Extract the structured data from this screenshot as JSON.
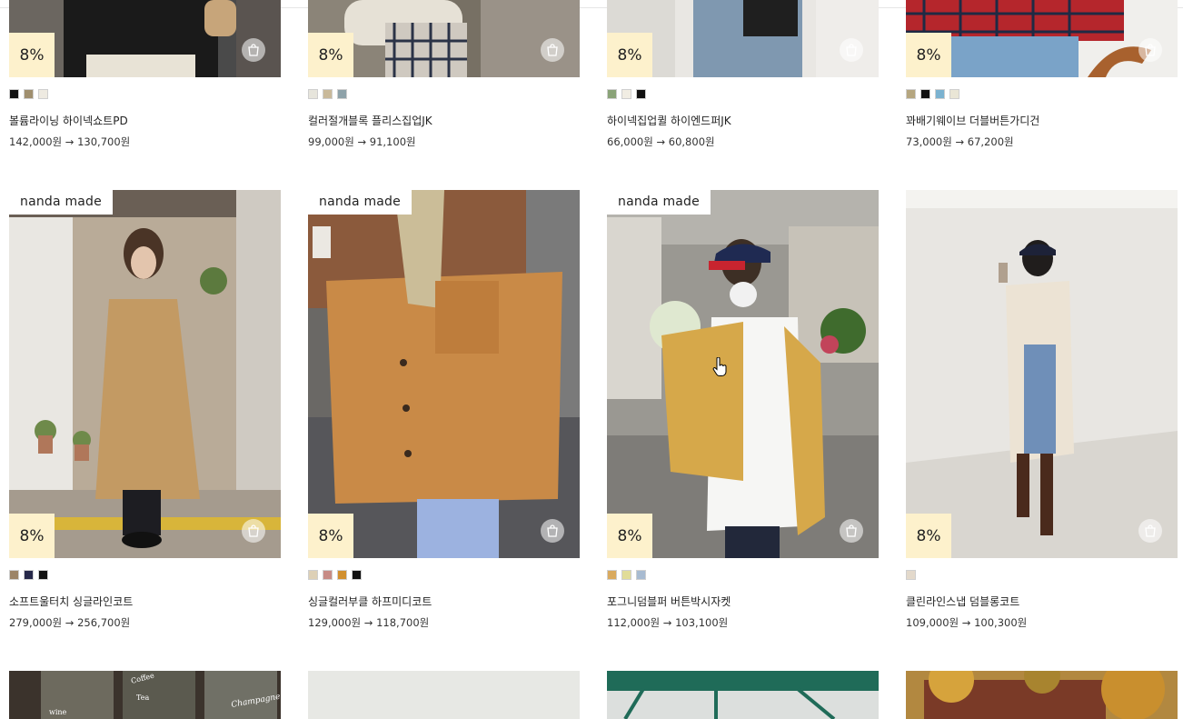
{
  "products": [
    {
      "made": "",
      "discount": "8%",
      "colors": [
        "#111111",
        "#a08f6e",
        "#eeeae1"
      ],
      "name": "볼륨라이닝 하이넥쇼트PD",
      "price": "142,000원 → 130,700원",
      "img": "row0-a"
    },
    {
      "made": "",
      "discount": "8%",
      "colors": [
        "#e7e5dc",
        "#c9b99a",
        "#8ea2a9"
      ],
      "name": "컬러절개블록 플리스집업JK",
      "price": "99,000원 → 91,100원",
      "img": "row0-b"
    },
    {
      "made": "",
      "discount": "8%",
      "colors": [
        "#8aa378",
        "#f1ede3",
        "#111111"
      ],
      "name": "하이넥집업퀼 하이엔드퍼JK",
      "price": "66,000원 → 60,800원",
      "img": "row0-c"
    },
    {
      "made": "",
      "discount": "8%",
      "colors": [
        "#b5a67f",
        "#111111",
        "#7bb2d0",
        "#eae6d6"
      ],
      "name": "꽈배기웨이브 더블버튼가디건",
      "price": "73,000원 → 67,200원",
      "img": "row0-d"
    },
    {
      "made": "nanda made",
      "discount": "8%",
      "colors": [
        "#9c8468",
        "#27294a",
        "#111111"
      ],
      "name": "소프트울터치 싱글라인코트",
      "price": "279,000원 → 256,700원",
      "img": "row1-a"
    },
    {
      "made": "nanda made",
      "discount": "8%",
      "colors": [
        "#ddd0b6",
        "#c78b85",
        "#d1902f",
        "#111111"
      ],
      "name": "싱글컬러부클 하프미디코트",
      "price": "129,000원 → 118,700원",
      "img": "row1-b"
    },
    {
      "made": "nanda made",
      "discount": "8%",
      "colors": [
        "#d9aa5f",
        "#e1dc98",
        "#a8bbd1"
      ],
      "name": "포그니덤블퍼 버튼박시자켓",
      "price": "112,000원 → 103,100원",
      "img": "row1-c"
    },
    {
      "made": "",
      "discount": "8%",
      "colors": [
        "#e3d9cb"
      ],
      "name": "클린라인스냅 덤블롱코트",
      "price": "109,000원 → 100,300원",
      "img": "row1-d"
    }
  ],
  "bottom_row": [
    {
      "img": "row2-a",
      "signs": [
        "Coffee",
        "Tea",
        "wine",
        "Champagne"
      ]
    },
    {
      "img": "row2-b"
    },
    {
      "img": "row2-c"
    },
    {
      "img": "row2-d"
    }
  ],
  "icons": {
    "cart": "shopping-bag-icon",
    "cursor": "hand-pointer-icon"
  }
}
